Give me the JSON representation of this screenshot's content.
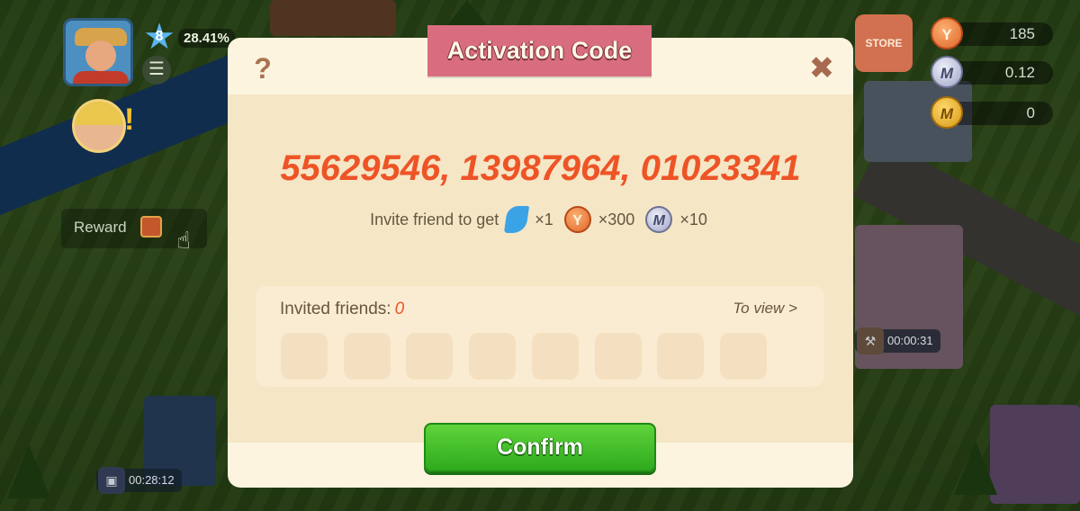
{
  "hud": {
    "level": "8",
    "xp_percent": "28.41%",
    "reward_label": "Reward",
    "timer_bottom_left": "00:28:12",
    "timer_right": "00:00:31",
    "store_label": "STORE",
    "resources": [
      {
        "icon": "orange-token-icon",
        "value": "185"
      },
      {
        "icon": "silver-m-coin-icon",
        "value": "0.12"
      },
      {
        "icon": "gold-m-coin-icon",
        "value": "0"
      }
    ]
  },
  "modal": {
    "title": "Activation Code",
    "codes": "55629546, 13987964, 01023341",
    "invite_text": "Invite friend to get",
    "rewards": [
      {
        "icon": "blue-gem-icon",
        "qty": "×1"
      },
      {
        "icon": "orange-token-icon",
        "qty": "×300"
      },
      {
        "icon": "silver-m-coin-icon",
        "qty": "×10"
      }
    ],
    "invited_label": "Invited friends:",
    "invited_count": "0",
    "to_view": "To view >",
    "confirm_label": "Confirm"
  },
  "colors": {
    "code_text": "#ee5426",
    "ribbon": "#d96d80",
    "confirm": "#3dbb25",
    "modal_bg": "#fcf4df"
  }
}
